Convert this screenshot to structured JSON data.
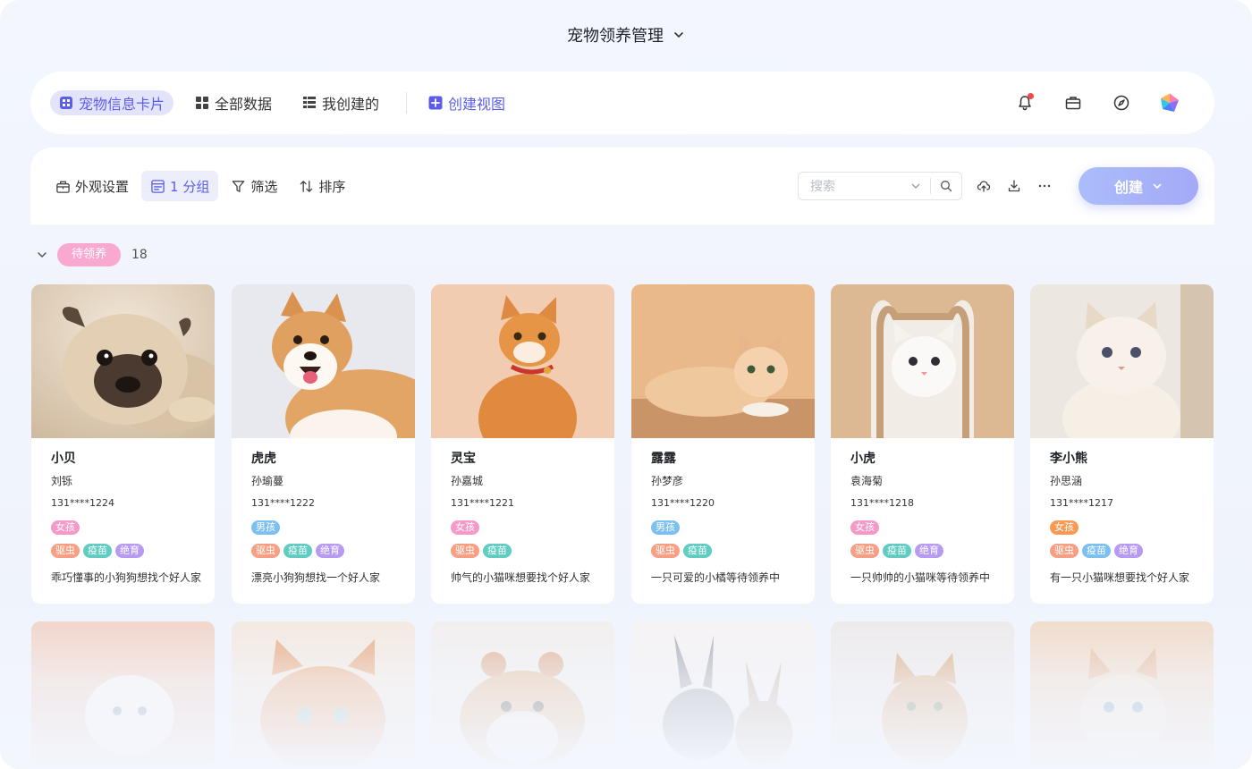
{
  "app": {
    "title": "宠物领养管理"
  },
  "nav": {
    "items": [
      {
        "label": "宠物信息卡片",
        "icon": "view-card-icon",
        "active": true
      },
      {
        "label": "全部数据",
        "icon": "grid-icon",
        "active": false
      },
      {
        "label": "我创建的",
        "icon": "table-icon",
        "active": false
      }
    ],
    "create_view": "创建视图",
    "right_icons": [
      "bell-icon",
      "briefcase-icon",
      "compass-icon",
      "app-logo-icon"
    ]
  },
  "toolbar": {
    "appearance": "外观设置",
    "group": "1 分组",
    "filter": "筛选",
    "sort": "排序",
    "search_placeholder": "搜索",
    "create_label": "创建"
  },
  "group": {
    "label": "待领养",
    "count": "18"
  },
  "cards": [
    {
      "pet": "小贝",
      "owner": "刘铄",
      "phone": "131****1224",
      "gender": "女孩",
      "gender_type": "girl",
      "tags": [
        "驱虫",
        "疫苗",
        "绝育"
      ],
      "desc": "乖巧懂事的小狗狗想找个好人家"
    },
    {
      "pet": "虎虎",
      "owner": "孙瑜蔓",
      "phone": "131****1222",
      "gender": "男孩",
      "gender_type": "boy",
      "tags": [
        "驱虫",
        "疫苗",
        "绝育"
      ],
      "desc": "漂亮小狗狗想找一个好人家"
    },
    {
      "pet": "灵宝",
      "owner": "孙嘉城",
      "phone": "131****1221",
      "gender": "女孩",
      "gender_type": "girl",
      "tags": [
        "驱虫",
        "疫苗"
      ],
      "desc": "帅气的小猫咪想要找个好人家"
    },
    {
      "pet": "露露",
      "owner": "孙梦彦",
      "phone": "131****1220",
      "gender": "男孩",
      "gender_type": "boy",
      "tags": [
        "驱虫",
        "疫苗"
      ],
      "desc": "一只可爱的小橘等待领养中"
    },
    {
      "pet": "小虎",
      "owner": "袁海菊",
      "phone": "131****1218",
      "gender": "女孩",
      "gender_type": "girl",
      "tags": [
        "驱虫",
        "疫苗",
        "绝育"
      ],
      "desc": "一只帅帅的小猫咪等待领养中"
    },
    {
      "pet": "李小熊",
      "owner": "孙思涵",
      "phone": "131****1217",
      "gender": "女孩",
      "gender_type": "girl-alt",
      "tags": [
        "驱虫",
        "疫苗",
        "绝育"
      ],
      "desc": "有一只小猫咪想要找个好人家"
    }
  ],
  "colors": {
    "accent": "#5b5de8",
    "nav_active_bg": "#e3e4fb",
    "group_tag": "#f9a8cf",
    "create_btn_start": "#aabdfb",
    "create_btn_end": "#a4a9f7"
  }
}
